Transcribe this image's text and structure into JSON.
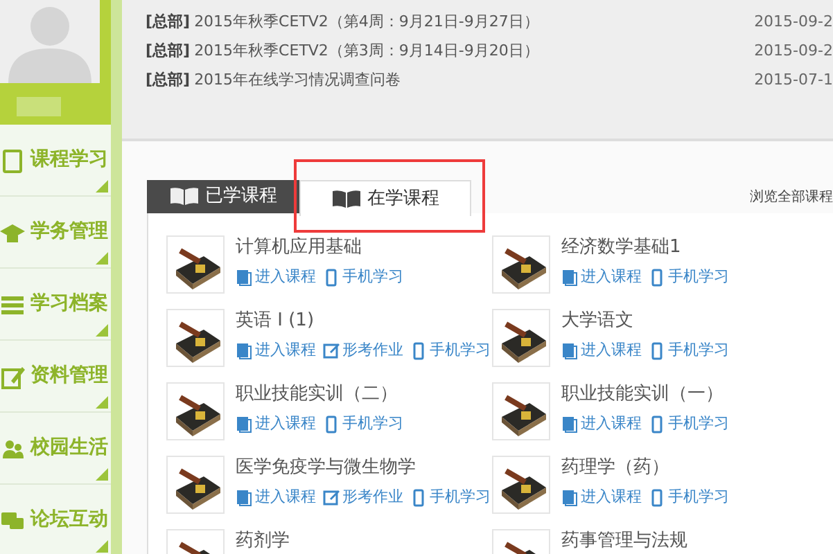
{
  "sidebar": {
    "items": [
      {
        "label": "课程学习"
      },
      {
        "label": "学务管理"
      },
      {
        "label": "学习档案"
      },
      {
        "label": "资料管理"
      },
      {
        "label": "校园生活"
      },
      {
        "label": "论坛互动"
      }
    ]
  },
  "notices": [
    {
      "tag": "[总部]",
      "title": "2015年秋季CETV2（第4周：9月21日-9月27日）",
      "date": "2015-09-2"
    },
    {
      "tag": "[总部]",
      "title": "2015年秋季CETV2（第3周：9月14日-9月20日）",
      "date": "2015-09-2"
    },
    {
      "tag": "[总部]",
      "title": "2015年在线学习情况调查问卷",
      "date": "2015-07-1"
    }
  ],
  "tabs": [
    {
      "label": "已学课程",
      "selected": false
    },
    {
      "label": "在学课程",
      "selected": true
    }
  ],
  "browse_all": "浏览全部课程",
  "courses": [
    {
      "name": "计算机应用基础",
      "links": [
        {
          "kind": "enter",
          "label": "进入课程"
        },
        {
          "kind": "mobile",
          "label": "手机学习"
        }
      ]
    },
    {
      "name": "经济数学基础1",
      "links": [
        {
          "kind": "enter",
          "label": "进入课程"
        },
        {
          "kind": "mobile",
          "label": "手机学习"
        }
      ]
    },
    {
      "name": "英语 I (1)",
      "links": [
        {
          "kind": "enter",
          "label": "进入课程"
        },
        {
          "kind": "homework",
          "label": "形考作业"
        },
        {
          "kind": "mobile",
          "label": "手机学习"
        }
      ]
    },
    {
      "name": "大学语文",
      "links": [
        {
          "kind": "enter",
          "label": "进入课程"
        },
        {
          "kind": "mobile",
          "label": "手机学习"
        }
      ]
    },
    {
      "name": "职业技能实训（二）",
      "links": [
        {
          "kind": "enter",
          "label": "进入课程"
        },
        {
          "kind": "mobile",
          "label": "手机学习"
        }
      ]
    },
    {
      "name": "职业技能实训（一）",
      "links": [
        {
          "kind": "enter",
          "label": "进入课程"
        },
        {
          "kind": "mobile",
          "label": "手机学习"
        }
      ]
    },
    {
      "name": "医学免疫学与微生物学",
      "links": [
        {
          "kind": "enter",
          "label": "进入课程"
        },
        {
          "kind": "homework",
          "label": "形考作业"
        },
        {
          "kind": "mobile",
          "label": "手机学习"
        }
      ]
    },
    {
      "name": "药理学（药）",
      "links": [
        {
          "kind": "enter",
          "label": "进入课程"
        },
        {
          "kind": "mobile",
          "label": "手机学习"
        }
      ]
    },
    {
      "name": "药剂学"
    },
    {
      "name": "药事管理与法规"
    }
  ]
}
